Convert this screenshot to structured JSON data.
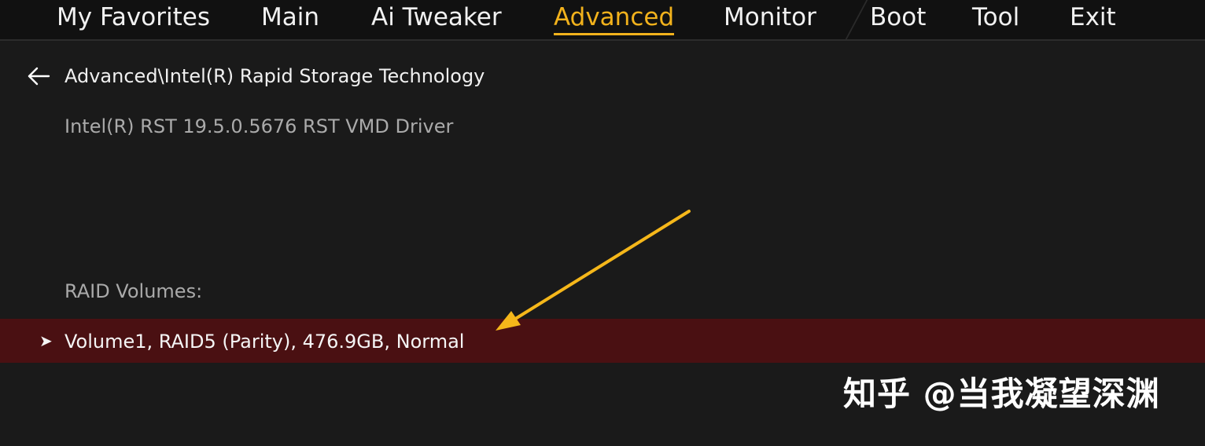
{
  "nav": {
    "tabs": [
      {
        "label": "My Favorites"
      },
      {
        "label": "Main"
      },
      {
        "label": "Ai Tweaker"
      },
      {
        "label": "Advanced",
        "active": true
      },
      {
        "label": "Monitor"
      },
      {
        "label": "Boot"
      },
      {
        "label": "Tool"
      },
      {
        "label": "Exit"
      }
    ]
  },
  "page": {
    "back_icon": "arrow-left-icon",
    "breadcrumb": "Advanced\\Intel(R) Rapid Storage Technology",
    "driver_info": "Intel(R) RST 19.5.0.5676 RST VMD Driver",
    "raid_section_label": "RAID Volumes:",
    "volumes": [
      {
        "label": "Volume1, RAID5 (Parity), 476.9GB, Normal",
        "selected": true
      }
    ]
  },
  "colors": {
    "accent": "#f2b21c",
    "selected_row": "#4a1012",
    "background": "#1a1a1a",
    "annotation_arrow": "#f5b71a"
  },
  "watermark": {
    "text": "知乎 @当我凝望深渊"
  }
}
